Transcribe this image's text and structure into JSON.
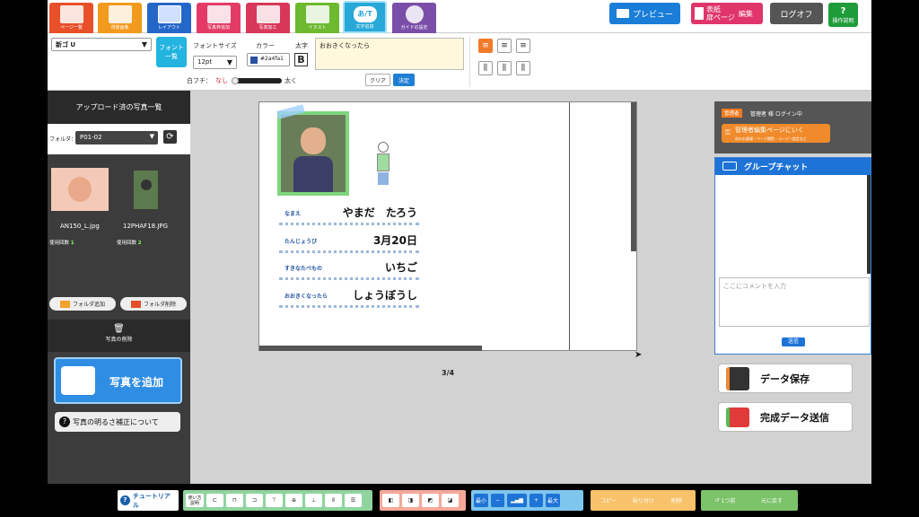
{
  "top_tabs": [
    {
      "label": "ページ一覧",
      "color": "#e8502a"
    },
    {
      "label": "背景画像",
      "color": "#f29a1e"
    },
    {
      "label": "レイアウト",
      "color": "#2467c8"
    },
    {
      "label": "写真枠追加",
      "color": "#e43b66"
    },
    {
      "label": "写真加工",
      "color": "#d9375a"
    },
    {
      "label": "イラスト",
      "color": "#6db92f"
    },
    {
      "label": "文字追加",
      "color": "#27a8d8"
    },
    {
      "label": "ガイドの設定",
      "color": "#7a4ea8"
    }
  ],
  "active_tab_label": "あ/T",
  "top_buttons": {
    "preview": "プレビュー",
    "cover_line1": "表紙",
    "cover_line2": "扉ページ",
    "edit": "編集",
    "logoff": "ログオフ",
    "help": "操作説明"
  },
  "toolbar": {
    "font_name": "新ゴ U",
    "font_list_line1": "フォント",
    "font_list_line2": "一覧",
    "font_size_label": "フォントサイズ",
    "font_size": "12pt",
    "color_label": "カラー",
    "color_value": "#2a4fa1",
    "bold_label": "太字",
    "bold_button": "B",
    "text_value": "おおきくなったら",
    "outline_label": "白フチ：",
    "outline_none": "なし",
    "outline_thick": "太く",
    "clear": "クリア",
    "apply": "決定"
  },
  "left_panel": {
    "title": "アップロード済の写真一覧",
    "folder_label": "フォルダ：",
    "folder_value": "P01-02",
    "photos": [
      {
        "name": "AN150_L.jpg",
        "uses_label": "使用回数",
        "uses": "1"
      },
      {
        "name": "12PHAF18.JPG",
        "uses_label": "使用回数",
        "uses": "2"
      }
    ],
    "add_folder": "フォルダ追加",
    "delete_folder": "フォルダ削除",
    "delete_photo": "写真の削除",
    "add_photo": "写真を追加",
    "brightness": "写真の明るさ補正について"
  },
  "page": {
    "rows": [
      {
        "key": "なまえ",
        "value": "やまだ　たろう"
      },
      {
        "key": "たんじょうび",
        "value": "3月20日"
      },
      {
        "key": "すきなたべもの",
        "value": "いちご"
      },
      {
        "key": "おおきくなったら",
        "value": "しょうぼうし"
      }
    ],
    "page_number": "3/4"
  },
  "right_panel": {
    "admin_badge": "管理者",
    "login_text": "管理者 様 ログイン中",
    "admin_link": "管理者編集ページにいく",
    "admin_link_sub": "他のお客様・ページ閲覧・コーデー設定など",
    "chat_title": "グループチャット",
    "comment_placeholder": "ここにコメントを入力",
    "send": "送信",
    "save": "データ保存",
    "submit": "完成データ送信"
  },
  "bottom": {
    "tutorial": "チュートリアル",
    "usage_line1": "使い方",
    "usage_line2": "説明",
    "zoom_min": "最小",
    "zoom_max": "最大",
    "copy": "コピー",
    "paste": "貼り付け",
    "delete": "削除",
    "undo": "1つ前",
    "redo": "元に戻す"
  }
}
